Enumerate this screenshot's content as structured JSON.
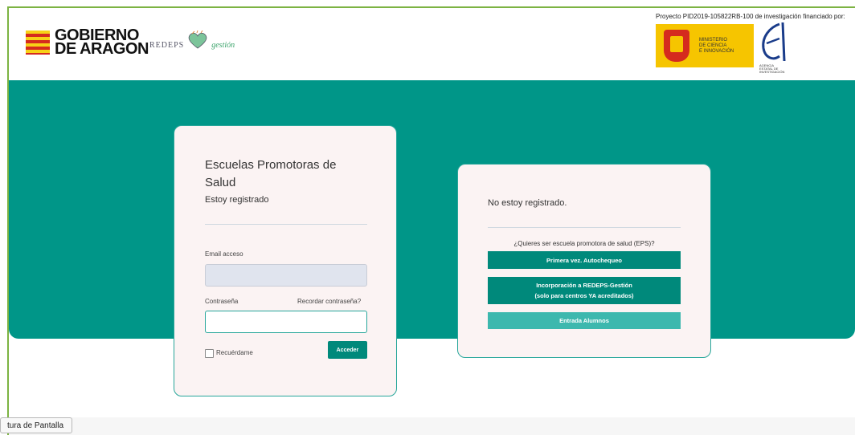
{
  "header": {
    "gobierno_line1": "GOBIERNO",
    "gobierno_line2": "DE ARAGON",
    "redeps": "REDEPS",
    "gestion": "gestión",
    "proyecto": "Proyecto PID2019-105822RB-100 de investigación financiado por:",
    "ministerio_l1": "Ministerio",
    "ministerio_l2": "de Ciencia",
    "ministerio_l3": "e Innovación",
    "aei_text": "AGENCIA ESTATAL DE INVESTIGACIÓN"
  },
  "login": {
    "title": "Escuelas Promotoras de Salud",
    "subtitle": "Estoy registrado",
    "email_label": "Email acceso",
    "email_value": "",
    "password_label": "Contraseña",
    "password_value": "",
    "recover_link": "Recordar contraseña?",
    "remember_label": "Recuérdame",
    "submit_label": "Acceder"
  },
  "register": {
    "title": "No estoy registrado.",
    "question": "¿Quieres ser escuela promotora de salud (EPS)?",
    "btn_first": "Primera vez. Autochequeo",
    "btn_incorp_l1": "Incorporación a REDEPS-Gestión",
    "btn_incorp_l2": "(solo para centros YA acreditados)",
    "btn_students": "Entrada Alumnos"
  },
  "tooltip": {
    "text": "tura de Pantalla"
  },
  "colors": {
    "teal": "#009688",
    "button": "#00897b",
    "button_light": "#3db8ae",
    "card_bg": "#fbf3f3"
  }
}
